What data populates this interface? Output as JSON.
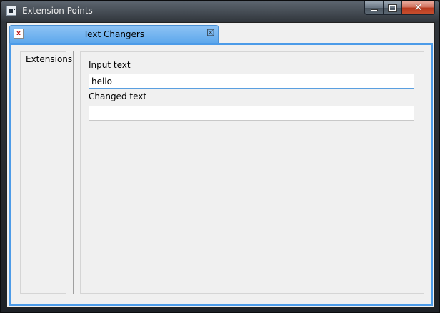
{
  "window": {
    "title": "Extension Points",
    "controls": {
      "minimize": "minimize",
      "maximize": "maximize",
      "close": "close"
    }
  },
  "tab": {
    "label": "Text Changers",
    "icon": "x",
    "close_icon": "⮽"
  },
  "left_pane": {
    "title": "Extensions"
  },
  "form": {
    "input_label": "Input text",
    "input_value": "hello",
    "output_label": "Changed text",
    "output_value": ""
  },
  "colors": {
    "tab_accent": "#5ea8ec",
    "view_border": "#4c9be8",
    "close_button": "#c8502f"
  }
}
